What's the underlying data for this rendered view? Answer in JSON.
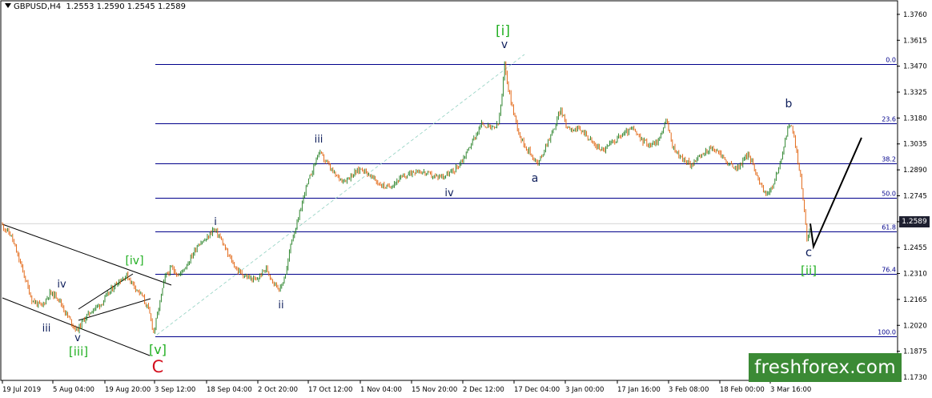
{
  "header": {
    "symbol": "GBPUSD,H4",
    "ohlc": "1.2553 1.2590 1.2545 1.2589"
  },
  "current_price_badge": "1.2589",
  "logo_text": "freshforex.com",
  "colors": {
    "candle_up": "#1b7a1b",
    "candle_down": "#e05a00",
    "fib_line": "#00008b",
    "label_green": "#22b022",
    "label_red": "#d4101e",
    "label_navy": "#0f1f5c"
  },
  "chart_data": {
    "type": "candlestick",
    "ylim": [
      1.173,
      1.38
    ],
    "y_ticks": [
      "1.3760",
      "1.3615",
      "1.3470",
      "1.3325",
      "1.3180",
      "1.3035",
      "1.2890",
      "1.2745",
      "1.2600",
      "1.2455",
      "1.2310",
      "1.2165",
      "1.2020",
      "1.1875",
      "1.1730"
    ],
    "x_ticks": [
      "19 Jul 2019",
      "5 Aug 04:00",
      "19 Aug 20:00",
      "3 Sep 12:00",
      "18 Sep 04:00",
      "2 Oct 20:00",
      "17 Oct 12:00",
      "1 Nov 04:00",
      "15 Nov 20:00",
      "2 Dec 12:00",
      "17 Dec 04:00",
      "3 Jan 00:00",
      "17 Jan 16:00",
      "3 Feb 08:00",
      "18 Feb 00:00",
      "3 Mar 16:00"
    ],
    "fib_levels": [
      {
        "label": "0.0",
        "price": 1.348
      },
      {
        "label": "23.6",
        "price": 1.315
      },
      {
        "label": "38.2",
        "price": 1.2925
      },
      {
        "label": "50.0",
        "price": 1.2735
      },
      {
        "label": "61.8",
        "price": 1.2545
      },
      {
        "label": "76.4",
        "price": 1.231
      },
      {
        "label": "100.0",
        "price": 1.196
      }
    ],
    "wave_labels": [
      {
        "text": "[i]",
        "color": "green"
      },
      {
        "text": "v",
        "color": "navy"
      },
      {
        "text": "iii",
        "color": "navy"
      },
      {
        "text": "i",
        "color": "navy"
      },
      {
        "text": "ii",
        "color": "navy"
      },
      {
        "text": "iv",
        "color": "navy"
      },
      {
        "text": "a",
        "color": "navy"
      },
      {
        "text": "b",
        "color": "navy"
      },
      {
        "text": "c",
        "color": "navy"
      },
      {
        "text": "[ii]",
        "color": "green"
      },
      {
        "text": "[iv]",
        "color": "green"
      },
      {
        "text": "iv",
        "color": "navy"
      },
      {
        "text": "iii",
        "color": "navy"
      },
      {
        "text": "v",
        "color": "navy"
      },
      {
        "text": "[iii]",
        "color": "green"
      },
      {
        "text": "[v]",
        "color": "green"
      },
      {
        "text": "C",
        "color": "red"
      }
    ],
    "price_path": [
      [
        0,
        1.2595
      ],
      [
        14,
        1.252
      ],
      [
        28,
        1.233
      ],
      [
        40,
        1.216
      ],
      [
        52,
        1.2125
      ],
      [
        62,
        1.22
      ],
      [
        72,
        1.218
      ],
      [
        82,
        1.209
      ],
      [
        90,
        1.203
      ],
      [
        96,
        1.199
      ],
      [
        106,
        1.206
      ],
      [
        116,
        1.211
      ],
      [
        126,
        1.214
      ],
      [
        136,
        1.22
      ],
      [
        146,
        1.226
      ],
      [
        158,
        1.23
      ],
      [
        168,
        1.224
      ],
      [
        178,
        1.218
      ],
      [
        186,
        1.21
      ],
      [
        192,
        1.198
      ],
      [
        198,
        1.211
      ],
      [
        206,
        1.229
      ],
      [
        214,
        1.234
      ],
      [
        224,
        1.23
      ],
      [
        236,
        1.238
      ],
      [
        248,
        1.248
      ],
      [
        258,
        1.25
      ],
      [
        266,
        1.256
      ],
      [
        274,
        1.252
      ],
      [
        284,
        1.242
      ],
      [
        296,
        1.233
      ],
      [
        308,
        1.229
      ],
      [
        320,
        1.227
      ],
      [
        332,
        1.234
      ],
      [
        342,
        1.226
      ],
      [
        350,
        1.222
      ],
      [
        358,
        1.233
      ],
      [
        364,
        1.25
      ],
      [
        372,
        1.26
      ],
      [
        380,
        1.276
      ],
      [
        388,
        1.286
      ],
      [
        398,
        1.299
      ],
      [
        408,
        1.293
      ],
      [
        418,
        1.286
      ],
      [
        430,
        1.283
      ],
      [
        442,
        1.287
      ],
      [
        452,
        1.29
      ],
      [
        464,
        1.285
      ],
      [
        474,
        1.281
      ],
      [
        484,
        1.279
      ],
      [
        496,
        1.283
      ],
      [
        508,
        1.286
      ],
      [
        520,
        1.289
      ],
      [
        532,
        1.287
      ],
      [
        544,
        1.285
      ],
      [
        556,
        1.286
      ],
      [
        566,
        1.288
      ],
      [
        578,
        1.295
      ],
      [
        590,
        1.305
      ],
      [
        602,
        1.315
      ],
      [
        614,
        1.312
      ],
      [
        622,
        1.314
      ],
      [
        627,
        1.33
      ],
      [
        630,
        1.348
      ],
      [
        636,
        1.332
      ],
      [
        642,
        1.32
      ],
      [
        650,
        1.307
      ],
      [
        658,
        1.301
      ],
      [
        666,
        1.296
      ],
      [
        672,
        1.292
      ],
      [
        682,
        1.303
      ],
      [
        692,
        1.312
      ],
      [
        700,
        1.323
      ],
      [
        708,
        1.313
      ],
      [
        718,
        1.312
      ],
      [
        730,
        1.31
      ],
      [
        742,
        1.303
      ],
      [
        754,
        1.3
      ],
      [
        766,
        1.305
      ],
      [
        778,
        1.309
      ],
      [
        790,
        1.312
      ],
      [
        800,
        1.306
      ],
      [
        812,
        1.303
      ],
      [
        822,
        1.305
      ],
      [
        832,
        1.317
      ],
      [
        840,
        1.302
      ],
      [
        850,
        1.296
      ],
      [
        862,
        1.292
      ],
      [
        874,
        1.296
      ],
      [
        886,
        1.301
      ],
      [
        898,
        1.299
      ],
      [
        910,
        1.292
      ],
      [
        922,
        1.29
      ],
      [
        934,
        1.298
      ],
      [
        944,
        1.288
      ],
      [
        954,
        1.276
      ],
      [
        962,
        1.277
      ],
      [
        970,
        1.286
      ],
      [
        978,
        1.3
      ],
      [
        986,
        1.316
      ],
      [
        992,
        1.307
      ],
      [
        998,
        1.29
      ],
      [
        1004,
        1.27
      ],
      [
        1008,
        1.248
      ],
      [
        1012,
        1.2589
      ]
    ],
    "projection": [
      [
        1012,
        1.2589
      ],
      [
        1016,
        1.246
      ],
      [
        1076,
        1.307
      ]
    ]
  }
}
